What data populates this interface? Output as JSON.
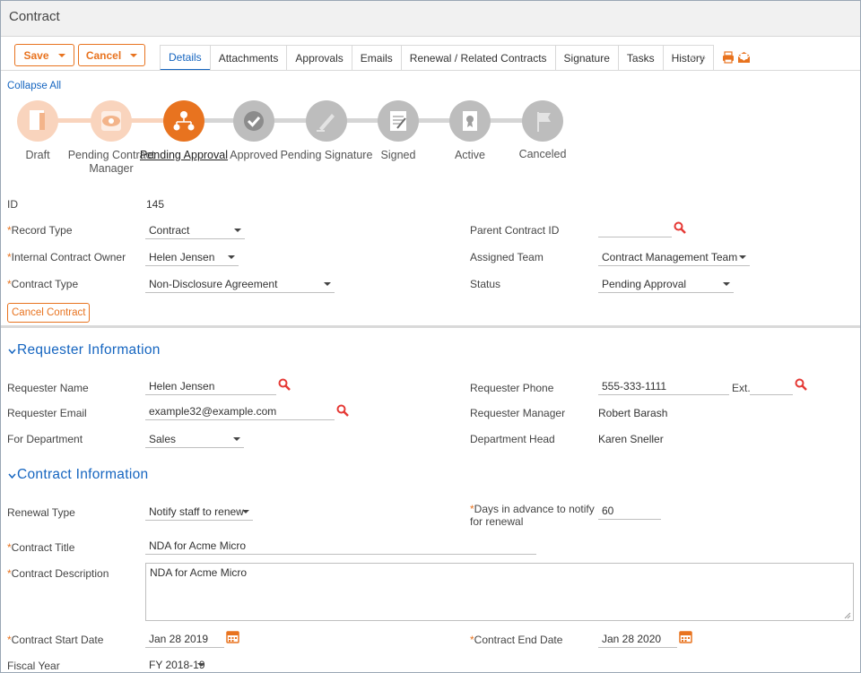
{
  "window": {
    "title": "Contract"
  },
  "toolbar": {
    "save_label": "Save",
    "cancel_label": "Cancel"
  },
  "tabs": [
    "Details",
    "Attachments",
    "Approvals",
    "Emails",
    "Renewal / Related Contracts",
    "Signature",
    "Tasks",
    "History"
  ],
  "tabs_overflow": "«  »",
  "collapse_all": "Collapse All",
  "workflow": {
    "steps": [
      {
        "label": "Draft",
        "state": "done",
        "icon": "document-icon"
      },
      {
        "label": "Pending Contract Manager",
        "state": "done",
        "icon": "eye-icon"
      },
      {
        "label": "Pending Approval",
        "state": "current",
        "icon": "people-hierarchy-icon"
      },
      {
        "label": "Approved",
        "state": "todo",
        "icon": "checkmark-icon"
      },
      {
        "label": "Pending Signature",
        "state": "todo",
        "icon": "pen-icon"
      },
      {
        "label": "Signed",
        "state": "todo",
        "icon": "signed-document-icon"
      },
      {
        "label": "Active",
        "state": "todo",
        "icon": "certificate-icon"
      },
      {
        "label": "Canceled",
        "state": "todo",
        "icon": "flag-icon"
      }
    ],
    "colors": {
      "done": "#f9d4bd",
      "current": "#e8731f",
      "todo": "#bdbdbd"
    }
  },
  "record": {
    "id_label": "ID",
    "id_value": "145",
    "record_type_label": "Record Type",
    "record_type_value": "Contract",
    "owner_label": "Internal Contract Owner",
    "owner_value": "Helen Jensen",
    "contract_type_label": "Contract Type",
    "contract_type_value": "Non-Disclosure Agreement",
    "parent_label": "Parent Contract ID",
    "parent_value": "",
    "team_label": "Assigned Team",
    "team_value": "Contract Management Team",
    "status_label": "Status",
    "status_value": "Pending Approval",
    "cancel_contract_label": "Cancel Contract"
  },
  "requester": {
    "section_title": "Requester Information",
    "name_label": "Requester Name",
    "name_value": "Helen Jensen",
    "email_label": "Requester Email",
    "email_value": "example32@example.com",
    "dept_label": "For Department",
    "dept_value": "Sales",
    "phone_label": "Requester Phone",
    "phone_value": "555-333-1111",
    "ext_label": "Ext.",
    "ext_value": "",
    "manager_label": "Requester Manager",
    "manager_value": "Robert Barash",
    "dept_head_label": "Department Head",
    "dept_head_value": "Karen Sneller"
  },
  "contract_info": {
    "section_title": "Contract Information",
    "renewal_label": "Renewal Type",
    "renewal_value": "Notify staff to renew",
    "days_label": "Days in advance to notify for renewal",
    "days_value": "60",
    "title_label": "Contract Title",
    "title_value": "NDA for Acme Micro",
    "desc_label": "Contract Description",
    "desc_value": "NDA for Acme Micro",
    "start_label": "Contract Start Date",
    "start_value": "Jan 28 2019",
    "end_label": "Contract End Date",
    "end_value": "Jan 28 2020",
    "fy_label": "Fiscal Year",
    "fy_value": "FY 2018-19"
  },
  "colors": {
    "accent": "#e8731f",
    "link": "#1565c0",
    "required": "#e8731f"
  }
}
